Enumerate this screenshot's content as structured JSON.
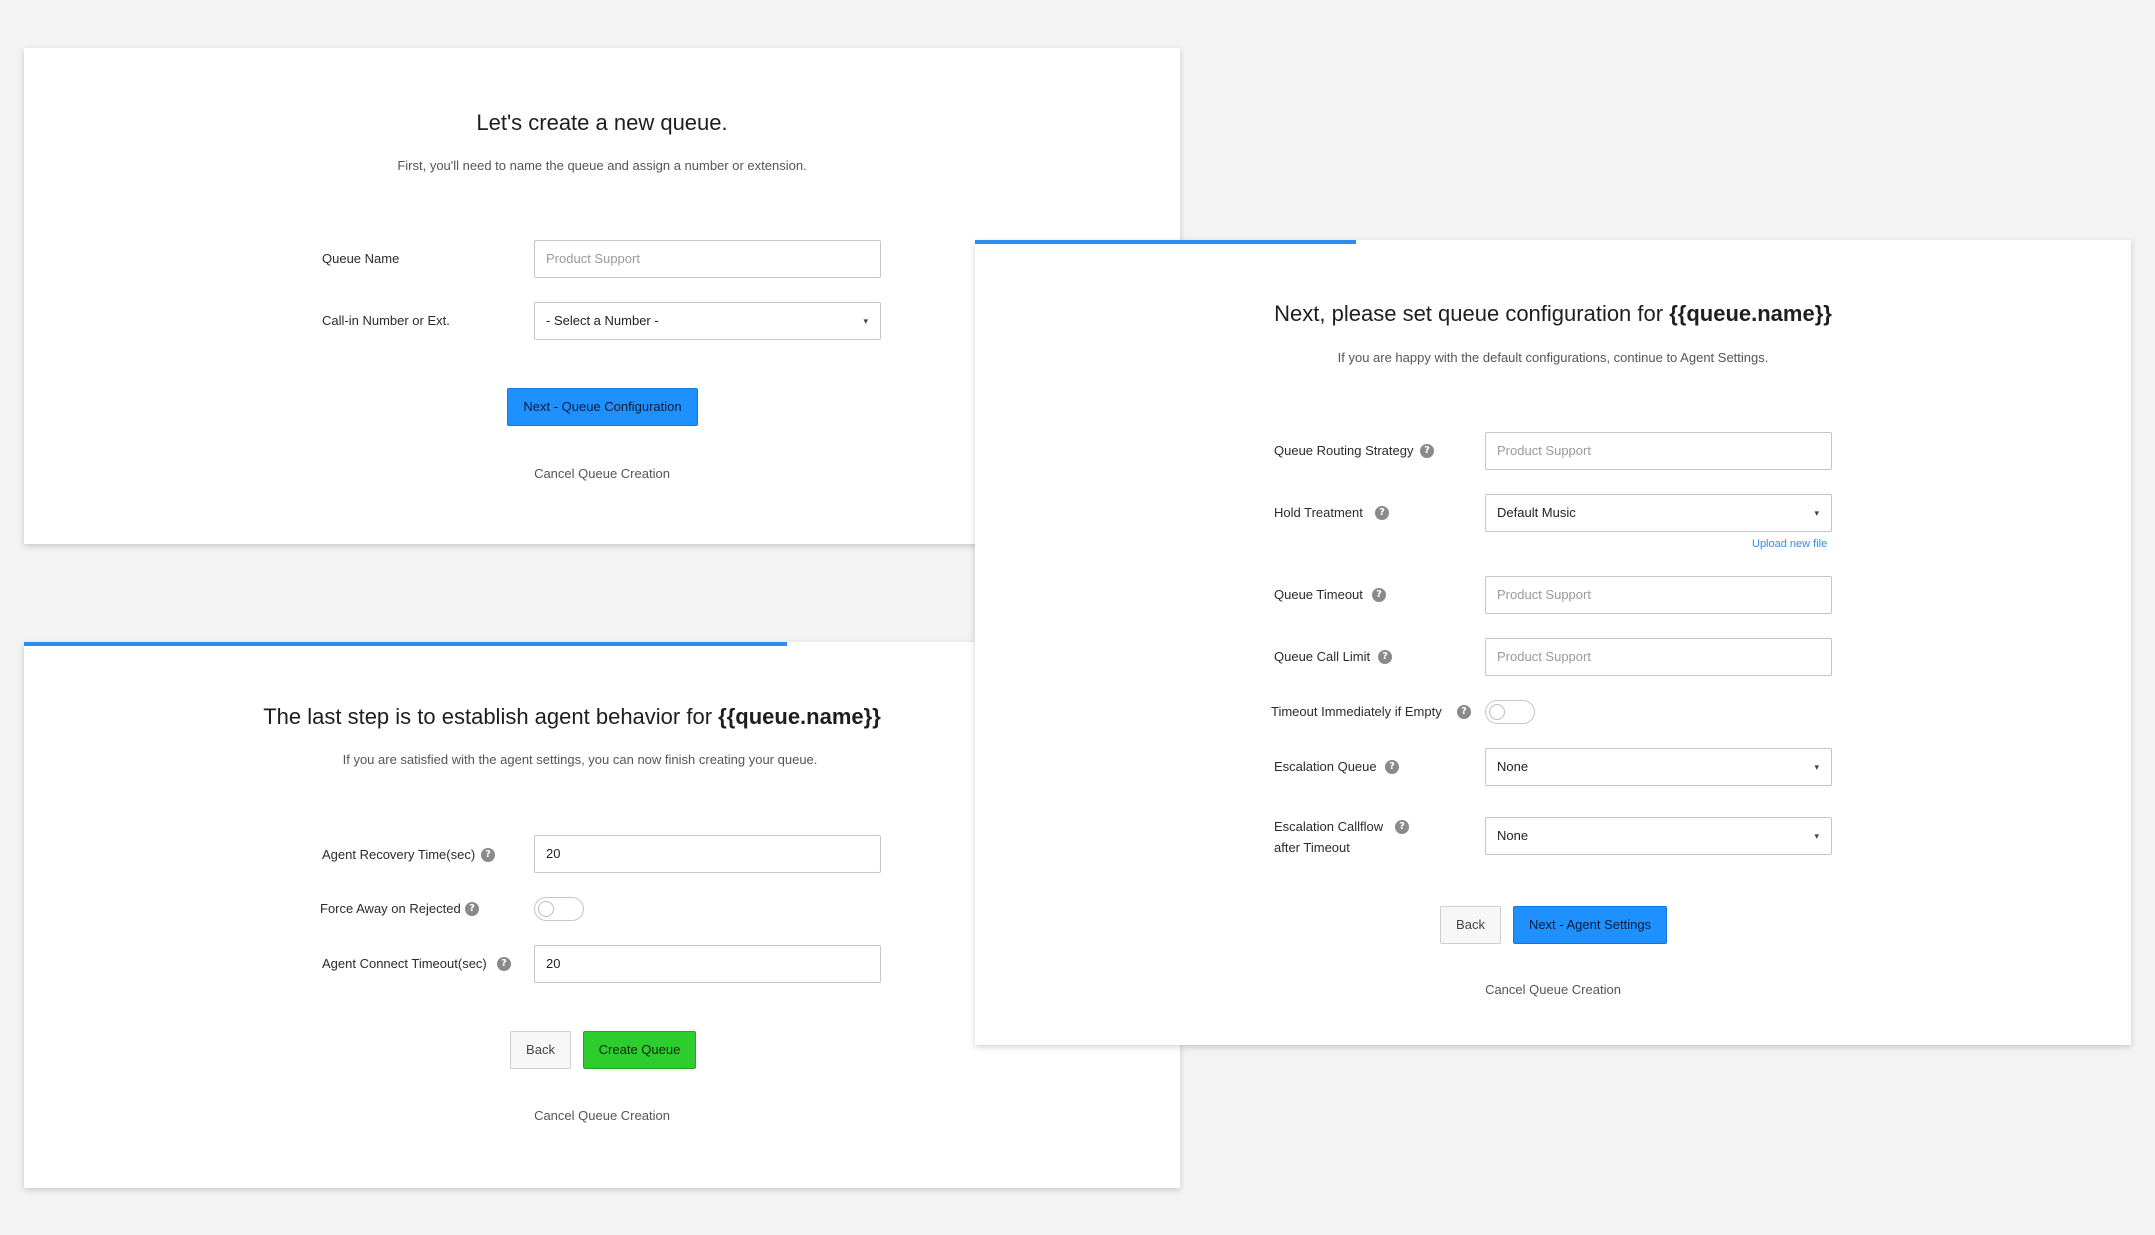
{
  "step1": {
    "title": "Let's create a new queue.",
    "subtitle": "First, you'll need to name the queue and assign a number or extension.",
    "fields": {
      "queue_name_label": "Queue Name",
      "queue_name_placeholder": "Product Support",
      "callin_label": "Call-in Number or Ext.",
      "callin_value": "- Select a Number -"
    },
    "next_button": "Next - Queue Configuration",
    "cancel_link": "Cancel Queue Creation"
  },
  "step2": {
    "title_prefix": "Next, please set queue configuration for ",
    "title_var": "{{queue.name}}",
    "subtitle": "If you are happy with the default configurations, continue to Agent Settings.",
    "progress": 0.33,
    "fields": {
      "routing_label": "Queue Routing Strategy",
      "routing_placeholder": "Product Support",
      "hold_label": "Hold Treatment",
      "hold_value": "Default Music",
      "upload_link": "Upload new file",
      "timeout_label": "Queue Timeout",
      "timeout_placeholder": "Product Support",
      "call_limit_label": "Queue Call Limit",
      "call_limit_placeholder": "Product Support",
      "timeout_empty_label": "Timeout Immediately if Empty",
      "timeout_empty_on": false,
      "escalation_queue_label": "Escalation Queue",
      "escalation_queue_value": "None",
      "escalation_callflow_label_line1": "Escalation Callflow",
      "escalation_callflow_label_line2": "after Timeout",
      "escalation_callflow_value": "None"
    },
    "back_button": "Back",
    "next_button": "Next - Agent Settings",
    "cancel_link": "Cancel Queue Creation"
  },
  "step3": {
    "title_prefix": "The last step is to establish agent behavior for ",
    "title_var": "{{queue.name}}",
    "subtitle": "If you are satisfied with the agent settings, you can now finish creating your queue.",
    "progress": 0.66,
    "fields": {
      "recovery_label": "Agent Recovery Time(sec)",
      "recovery_value": "20",
      "force_away_label": "Force Away on Rejected",
      "force_away_on": false,
      "connect_timeout_label": "Agent Connect Timeout(sec)",
      "connect_timeout_value": "20"
    },
    "back_button": "Back",
    "create_button": "Create Queue",
    "cancel_link": "Cancel Queue Creation"
  },
  "help_glyph": "?",
  "caret_glyph": "▾",
  "colors": {
    "background": "#f3f3f3",
    "accent": "#1e90ff",
    "success": "#2ccd2c",
    "progress": "#2a8ef0"
  }
}
